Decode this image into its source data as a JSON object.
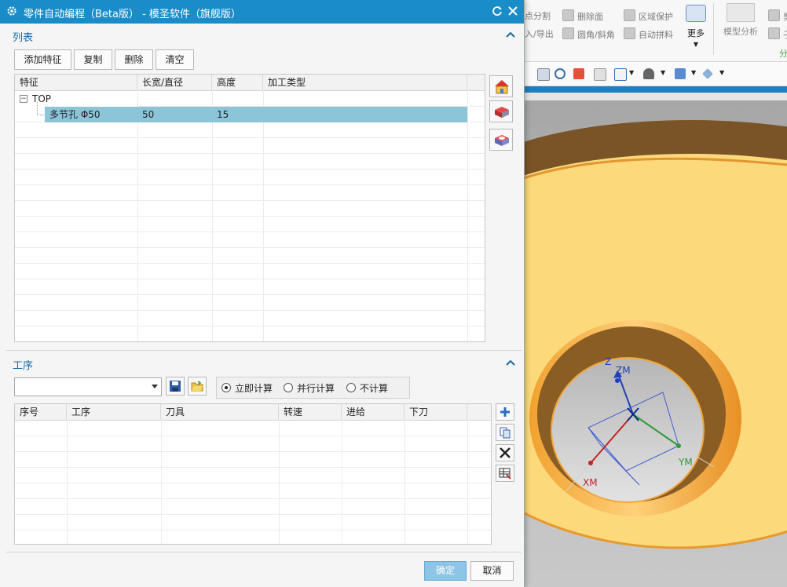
{
  "dialog": {
    "title": "零件自动编程（Beta版） - 模圣软件（旗舰版）",
    "list_section": {
      "label": "列表",
      "buttons": [
        "添加特征",
        "复制",
        "删除",
        "清空"
      ],
      "columns": [
        "特征",
        "长宽/直径",
        "高度",
        "加工类型"
      ],
      "tree_root": "TOP",
      "rows": [
        {
          "feature": "多节孔 Φ50",
          "size": "50",
          "height": "15",
          "type": ""
        }
      ],
      "side_icons": [
        "house-icon",
        "block-icon",
        "block-pocket-icon"
      ]
    },
    "process_section": {
      "label": "工序",
      "select_value": "",
      "radios": [
        {
          "label": "立即计算",
          "checked": true
        },
        {
          "label": "并行计算",
          "checked": false
        },
        {
          "label": "不计算",
          "checked": false
        }
      ],
      "columns": [
        "序号",
        "工序",
        "刀具",
        "转速",
        "进给",
        "下刀"
      ],
      "side_icons": [
        "plus-icon",
        "copy-icon",
        "delete-x-icon",
        "edit-table-icon"
      ]
    },
    "ok_label": "确定",
    "cancel_label": "取消"
  },
  "ribbon": {
    "items": [
      {
        "label": "点分割"
      },
      {
        "label": "删除面"
      },
      {
        "label": "区域保护"
      },
      {
        "label": "入/导出"
      },
      {
        "label": "圆角/斜角"
      },
      {
        "label": "自动拼料"
      }
    ],
    "more_label": "更多",
    "model_analysis_label": "模型分析",
    "right_partial_1": "剪",
    "right_partial_2": "子",
    "group_partial": "分"
  },
  "viewport": {
    "axis_labels": [
      "Z",
      "ZM",
      "XM",
      "YM"
    ]
  },
  "colors": {
    "title_bar": "#1a8dc8",
    "section_label": "#1a6aa8",
    "selected_row": "#8cc4d8",
    "ok_button": "#8cc5e6",
    "part_yellow": "#fcd97b"
  }
}
